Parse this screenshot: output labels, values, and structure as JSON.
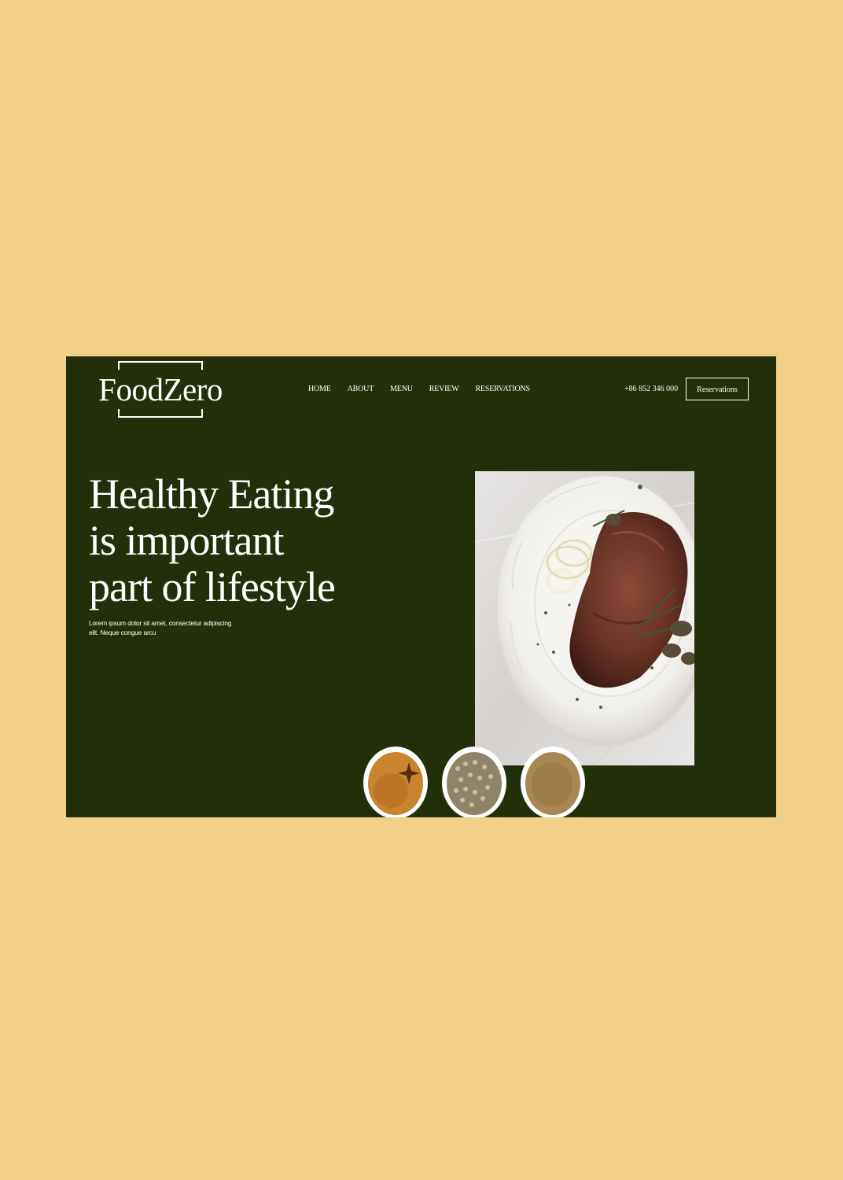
{
  "brand": {
    "name": "FoodZero"
  },
  "nav": {
    "items": [
      "HOME",
      "ABOUT",
      "MENU",
      "REVIEW",
      "RESERVATIONS"
    ]
  },
  "header": {
    "phone": "+86 852 346 000",
    "reservation_button": "Reservations"
  },
  "hero": {
    "headline_lines": [
      "Healthy Eating",
      "is important",
      "part of lifestyle"
    ],
    "subtext_lines": [
      "Lorem ipsum dolor sit amet, consectetur adipiscing",
      "elit. Neque congue arcu"
    ]
  },
  "colors": {
    "page_background": "#F1D087",
    "hero_background": "#232F0A",
    "text": "#FFFFFF"
  },
  "images": {
    "main": "steak-plate-photo",
    "bowls": [
      "cinnamon-star-anise-bowl",
      "white-peppercorn-bowl",
      "ground-spice-bowl"
    ]
  }
}
